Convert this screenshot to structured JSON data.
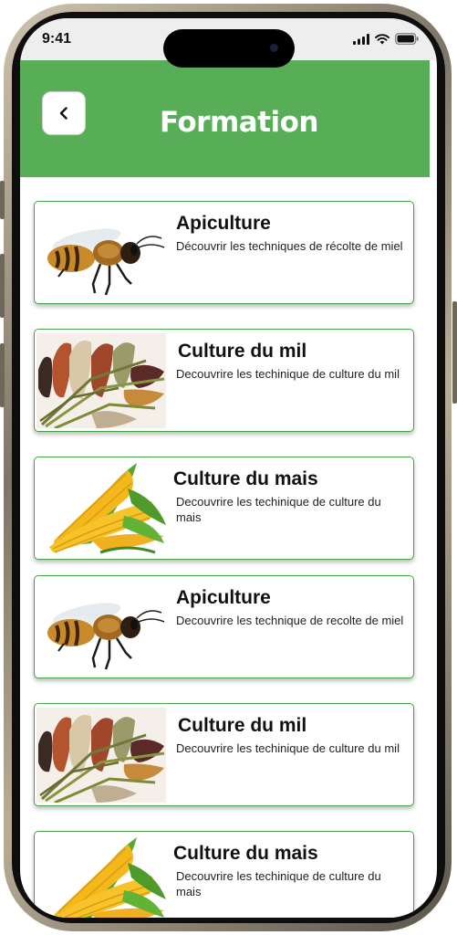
{
  "status_bar": {
    "time": "9:41",
    "icons": [
      "cellular-signal-icon",
      "wifi-icon",
      "battery-icon"
    ]
  },
  "header": {
    "title": "Formation",
    "back_icon": "chevron-left-icon",
    "background_color": "#57ae57"
  },
  "courses": [
    {
      "title": "Apiculture",
      "description": "Découvrir les techniques de récolte de miel",
      "image": "bee-image"
    },
    {
      "title": "Culture du mil",
      "description": "Decouvrire les techinique de culture du mil",
      "image": "millet-image"
    },
    {
      "title": "Culture du mais",
      "description": "Decouvrire les techinique de culture du mais",
      "image": "corn-image"
    },
    {
      "title": "Apiculture",
      "description": "Decouvrire les technique de recolte de miel",
      "image": "bee-image"
    },
    {
      "title": "Culture du mil",
      "description": "Decouvrire les techinique de culture du mil",
      "image": "millet-image"
    },
    {
      "title": "Culture du mais",
      "description": "Decouvrire les techinique de culture du mais",
      "image": "corn-image"
    }
  ]
}
